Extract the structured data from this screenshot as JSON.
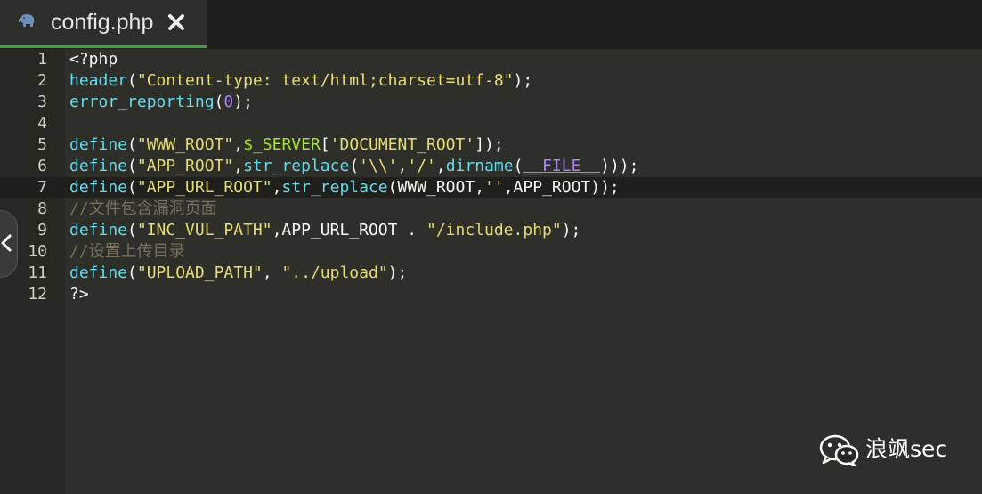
{
  "tab": {
    "title": "config.php",
    "icon": "php-elephant-icon",
    "close_icon": "close-icon"
  },
  "gutter": {
    "line_numbers": [
      "1",
      "2",
      "3",
      "4",
      "5",
      "6",
      "7",
      "8",
      "9",
      "10",
      "11",
      "12"
    ]
  },
  "code": {
    "l1": "<?php",
    "l2": {
      "fn": "header",
      "p1": "(",
      "s1": "\"Content-type: text/html;charset=utf-8\"",
      "p2": ");"
    },
    "l3": {
      "fn": "error_reporting",
      "p1": "(",
      "n1": "0",
      "p2": ");"
    },
    "l4": "",
    "l5": {
      "fn": "define",
      "p1": "(",
      "s1": "\"WWW_ROOT\"",
      "p2": ",",
      "v1": "$_SERVER",
      "p3": "[",
      "s2": "'DOCUMENT_ROOT'",
      "p4": "]);"
    },
    "l6": {
      "fn": "define",
      "p1": "(",
      "s1": "\"APP_ROOT\"",
      "p2": ",",
      "fn2": "str_replace",
      "p3": "(",
      "s2": "'\\\\'",
      "p4": ",",
      "s3": "'/'",
      "p5": ",",
      "fn3": "dirname",
      "p6": "(",
      "c1": "__FILE__",
      "p7": ")));"
    },
    "l7": {
      "fn": "define",
      "p1": "(",
      "s1": "\"APP_URL_ROOT\"",
      "p2": ",",
      "fn2": "str_replace",
      "p3": "(WWW_ROOT,",
      "s2": "''",
      "p4": ",APP_ROOT));"
    },
    "l8": "//文件包含漏洞页面",
    "l9": {
      "fn": "define",
      "p1": "(",
      "s1": "\"INC_VUL_PATH\"",
      "p2": ",APP_URL_ROOT . ",
      "s2": "\"/include.php\"",
      "p3": ");"
    },
    "l10": "//设置上传目录",
    "l11": {
      "fn": "define",
      "p1": "(",
      "s1": "\"UPLOAD_PATH\"",
      "p2": ", ",
      "s2": "\"../upload\"",
      "p3": ");"
    },
    "l12": "?>"
  },
  "side_handle": {
    "icon": "chevron-left-icon"
  },
  "watermark": {
    "icon": "wechat-icon",
    "text": "浪飒sec"
  },
  "colors": {
    "background": "#272822",
    "active_tab_border": "#3fa03f",
    "keyword": "#66d9ef",
    "string": "#e6db74",
    "number": "#ae81ff",
    "variable": "#a6e22e",
    "comment": "#75715e"
  }
}
